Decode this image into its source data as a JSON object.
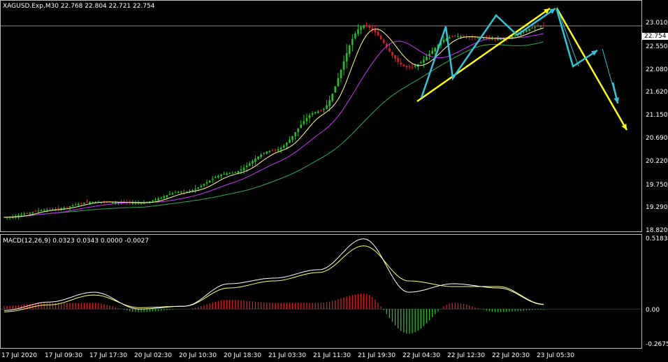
{
  "window": {
    "symbol_header": "XAGUSD.Exp,M30",
    "ohlc": [
      "22.768",
      "22.804",
      "22.721",
      "22.754"
    ]
  },
  "price_panel": {
    "current_price": "22.754",
    "y_ticks": [
      "23.010",
      "22.550",
      "22.080",
      "21.620",
      "21.150",
      "20.690",
      "20.220",
      "19.750",
      "19.290",
      "18.820"
    ]
  },
  "macd_panel": {
    "label": "MACD(12,26,9)",
    "values": [
      "0.0323",
      "0.0343",
      "0.0000",
      "-0.0027"
    ],
    "y_ticks": [
      "0.5183",
      "0.00",
      "-0.2675"
    ]
  },
  "time_axis": {
    "labels": [
      "17 Jul 2020",
      "17 Jul 09:30",
      "17 Jul 17:30",
      "20 Jul 02:30",
      "20 Jul 10:30",
      "20 Jul 18:30",
      "21 Jul 03:30",
      "21 Jul 11:30",
      "21 Jul 19:30",
      "22 Jul 04:30",
      "22 Jul 12:30",
      "22 Jul 20:30",
      "23 Jul 05:30"
    ]
  },
  "colors": {
    "background": "#000000",
    "bull": "#22c322",
    "bear": "#e01e1e",
    "ma_fast": "#ffff99",
    "ma_mid": "#cc33ff",
    "ma_slow": "#33aa55",
    "annotation_yellow": "#ffff00",
    "annotation_cyan": "#2fc6dc",
    "macd_line": "#ffffff",
    "signal_line": "#ffff66"
  },
  "chart_data": [
    {
      "type": "candlestick",
      "series": [
        {
          "name": "close",
          "x": [
            "17 Jul 2020",
            "17 Jul 09:30",
            "17 Jul 17:30",
            "20 Jul 02:30",
            "20 Jul 10:30",
            "20 Jul 18:30",
            "21 Jul 03:30",
            "21 Jul 11:30",
            "21 Jul 19:30",
            "22 Jul 04:30",
            "22 Jul 12:30",
            "22 Jul 20:30",
            "23 Jul 05:30"
          ],
          "values": [
            19.05,
            19.2,
            19.35,
            19.33,
            19.55,
            19.9,
            20.35,
            21.1,
            22.75,
            21.95,
            22.55,
            22.5,
            22.754
          ]
        }
      ],
      "ylim": [
        18.82,
        23.2
      ]
    },
    {
      "type": "line",
      "series": [
        {
          "name": "MACD",
          "x": [
            "17 Jul 2020",
            "17 Jul 09:30",
            "17 Jul 17:30",
            "20 Jul 02:30",
            "20 Jul 10:30",
            "20 Jul 18:30",
            "21 Jul 03:30",
            "21 Jul 11:30",
            "21 Jul 19:30",
            "22 Jul 04:30",
            "22 Jul 12:30",
            "22 Jul 20:30",
            "23 Jul 05:30"
          ],
          "values": [
            -0.01,
            0.05,
            0.12,
            0.0,
            0.02,
            0.18,
            0.22,
            0.28,
            0.5,
            0.12,
            0.18,
            0.15,
            0.0323
          ]
        },
        {
          "name": "Signal",
          "x": [
            "17 Jul 2020",
            "17 Jul 09:30",
            "17 Jul 17:30",
            "20 Jul 02:30",
            "20 Jul 10:30",
            "20 Jul 18:30",
            "21 Jul 03:30",
            "21 Jul 11:30",
            "21 Jul 19:30",
            "22 Jul 04:30",
            "22 Jul 12:30",
            "22 Jul 20:30",
            "23 Jul 05:30"
          ],
          "values": [
            -0.02,
            0.03,
            0.1,
            0.01,
            0.02,
            0.15,
            0.2,
            0.26,
            0.45,
            0.2,
            0.16,
            0.16,
            0.0343
          ]
        }
      ],
      "ylim": [
        -0.2675,
        0.5183
      ]
    }
  ]
}
